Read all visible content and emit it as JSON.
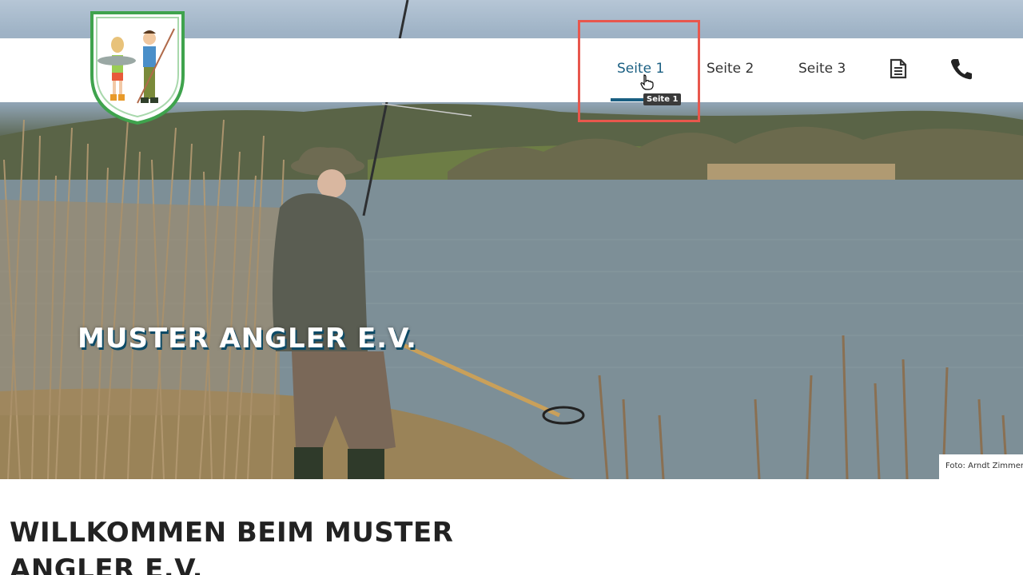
{
  "header": {
    "logo_icon": "club-crest-logo",
    "nav": {
      "items": [
        {
          "label": "Seite 1",
          "active": true
        },
        {
          "label": "Seite 2",
          "active": false
        },
        {
          "label": "Seite 3",
          "active": false
        }
      ],
      "icons": [
        "document-icon",
        "phone-icon"
      ],
      "tooltip": "Seite 1"
    }
  },
  "hero": {
    "title": "MUSTER ANGLER E.V.",
    "photo_credit": "Foto: Arndt Zimmermann"
  },
  "content": {
    "welcome_heading": "WILLKOMMEN BEIM MUSTER ANGLER E.V."
  },
  "colors": {
    "accent": "#1a5f82",
    "highlight": "#e8574d",
    "text": "#333333"
  }
}
